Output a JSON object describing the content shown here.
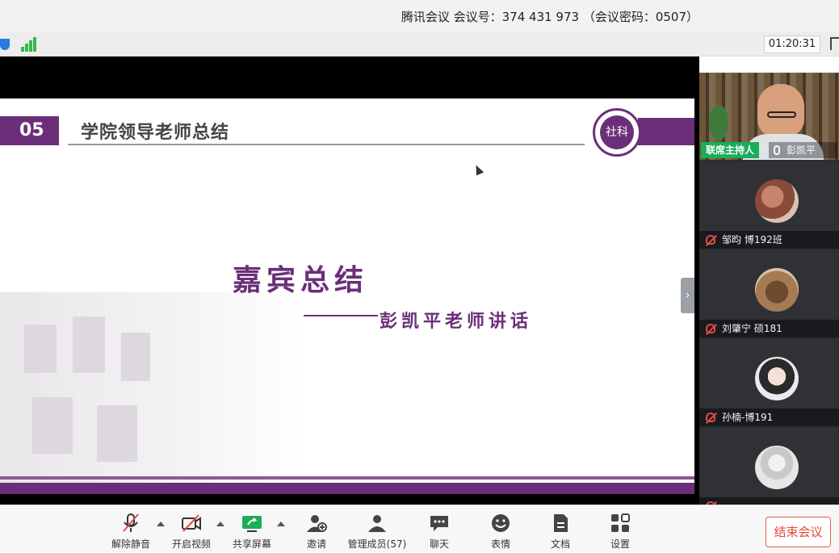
{
  "window": {
    "title": "腾讯会议 会议号：374 431 973 （会议密码：0507）",
    "timer": "01:20:31"
  },
  "slide": {
    "section_number": "05",
    "section_title": "学院领导老师总结",
    "logo_text": "社科",
    "headline": "嘉宾总结",
    "subtitle": "彭凯平老师讲话"
  },
  "participants": {
    "host": {
      "badge": "联席主持人",
      "name": "彭凯平"
    },
    "members": [
      {
        "name": "邹昀 博192班",
        "avatar": "avatar-toys"
      },
      {
        "name": "刘肇宁 硕181",
        "avatar": "avatar-drinks"
      },
      {
        "name": "孙楠-博191",
        "avatar": "avatar-cartoon-girl"
      },
      {
        "name": "",
        "avatar": "avatar-default"
      }
    ]
  },
  "toolbar": {
    "unmute": "解除静音",
    "start_video": "开启视频",
    "share_screen": "共享屏幕",
    "invite": "邀请",
    "manage_members": "管理成员(57)",
    "chat": "聊天",
    "reactions": "表情",
    "docs": "文档",
    "settings": "设置",
    "end_meeting": "结束会议"
  },
  "colors": {
    "brand_purple": "#6b2f7a",
    "host_green": "#1aad5a",
    "muted_red": "#e24a4a",
    "end_red": "#e04a3a"
  }
}
